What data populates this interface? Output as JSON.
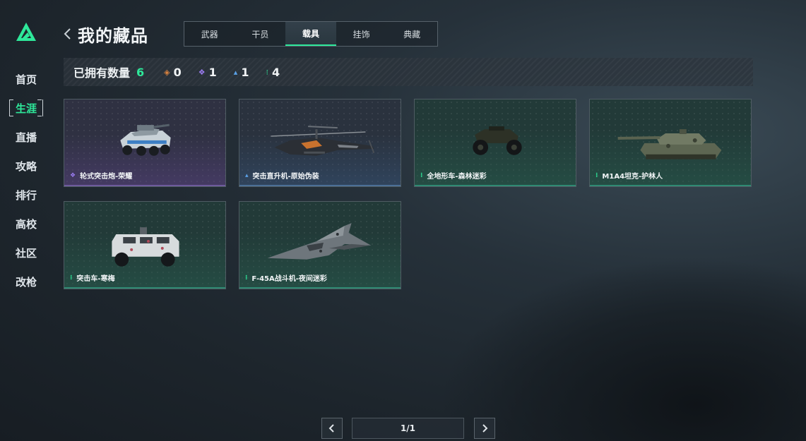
{
  "sidebar": {
    "items": [
      {
        "label": "首页",
        "active": false
      },
      {
        "label": "生涯",
        "active": true
      },
      {
        "label": "直播",
        "active": false
      },
      {
        "label": "攻略",
        "active": false
      },
      {
        "label": "排行",
        "active": false
      },
      {
        "label": "高校",
        "active": false
      },
      {
        "label": "社区",
        "active": false
      },
      {
        "label": "改枪",
        "active": false
      }
    ]
  },
  "header": {
    "title": "我的藏品",
    "tabs": [
      {
        "label": "武器",
        "active": false
      },
      {
        "label": "干员",
        "active": false
      },
      {
        "label": "载具",
        "active": true
      },
      {
        "label": "挂饰",
        "active": false
      },
      {
        "label": "典藏",
        "active": false
      }
    ]
  },
  "stats": {
    "label": "已拥有数量",
    "total": "6",
    "rarities": [
      {
        "icon": "orange-diamond-icon",
        "color": "#d9823f",
        "symbol": "◈",
        "count": "0"
      },
      {
        "icon": "purple-diamonds-icon",
        "color": "#9a7cf0",
        "symbol": "❖",
        "count": "1"
      },
      {
        "icon": "blue-triangle-icon",
        "color": "#5aa0e6",
        "symbol": "▴",
        "count": "1"
      },
      {
        "icon": "green-dots-icon",
        "color": "#2ee89a",
        "symbol": "⁝",
        "count": "4"
      }
    ]
  },
  "cards": [
    {
      "name": "轮式突击炮-荣耀",
      "rarity": "purple",
      "icon": "purple-diamonds-icon",
      "color": "#9a7cf0",
      "symbol": "❖",
      "art": "armored-car"
    },
    {
      "name": "突击直升机-原始伪装",
      "rarity": "blue",
      "icon": "blue-triangle-icon",
      "color": "#5aa0e6",
      "symbol": "▴",
      "art": "helicopter"
    },
    {
      "name": "全地形车-森林迷彩",
      "rarity": "green",
      "icon": "green-dots-icon",
      "color": "#2ee89a",
      "symbol": "⁝",
      "art": "atv"
    },
    {
      "name": "M1A4坦克-护林人",
      "rarity": "green",
      "icon": "green-dots-icon",
      "color": "#2ee89a",
      "symbol": "⁝",
      "art": "tank"
    },
    {
      "name": "突击车-寒梅",
      "rarity": "green",
      "icon": "green-dots-icon",
      "color": "#2ee89a",
      "symbol": "⁝",
      "art": "assault-vehicle"
    },
    {
      "name": "F-45A战斗机-夜间迷彩",
      "rarity": "green",
      "icon": "green-dots-icon",
      "color": "#2ee89a",
      "symbol": "⁝",
      "art": "fighter-jet"
    }
  ],
  "pagination": {
    "text": "1/1"
  }
}
